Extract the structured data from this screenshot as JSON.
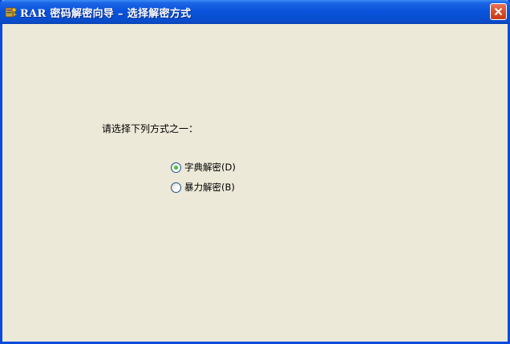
{
  "window": {
    "title": "RAR 密码解密向导 – 选择解密方式"
  },
  "content": {
    "prompt": "请选择下列方式之一：",
    "options": [
      {
        "label": "字典解密(D)",
        "selected": true
      },
      {
        "label": "暴力解密(B)",
        "selected": false
      }
    ]
  },
  "icons": {
    "app": "rar-key-app-icon",
    "close": "close-icon"
  },
  "colors": {
    "titlebar": "#0a53dc",
    "background": "#ece9d8",
    "close_button": "#d94f2b",
    "radio_selected": "#21a121"
  }
}
